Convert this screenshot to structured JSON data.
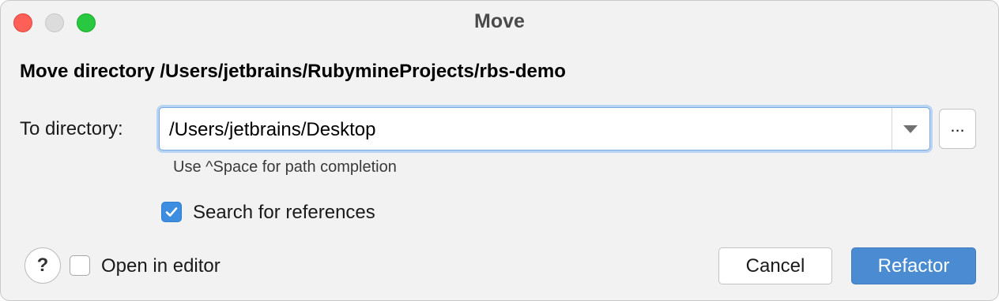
{
  "window": {
    "title": "Move"
  },
  "dialog": {
    "heading": "Move directory /Users/jetbrains/RubymineProjects/rbs-demo",
    "to_directory_label": "To directory:",
    "to_directory_value": "/Users/jetbrains/Desktop",
    "browse_label": "...",
    "hint": "Use ^Space for path completion",
    "search_references": {
      "label": "Search for references",
      "checked": true
    },
    "open_in_editor": {
      "label": "Open in editor",
      "checked": false
    },
    "help_label": "?"
  },
  "buttons": {
    "cancel": "Cancel",
    "refactor": "Refactor"
  },
  "colors": {
    "accent": "#4a8bd1",
    "checkbox_checked": "#3d8ee0",
    "close": "#fe5f57",
    "maximize": "#28c840"
  }
}
